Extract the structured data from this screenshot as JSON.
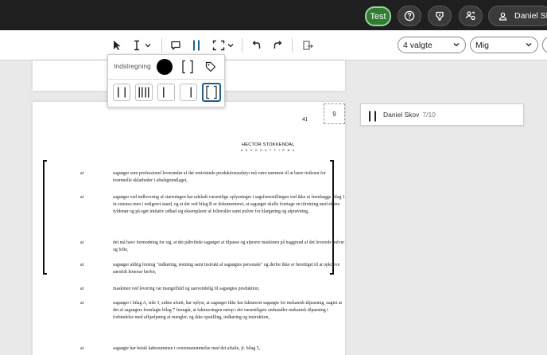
{
  "topbar": {
    "test_label": "Test",
    "help_icon": "help-circle-icon",
    "download_icon": "download-icon",
    "people_icon": "people-icon",
    "user_name": "Daniel Sk"
  },
  "toolbar": {
    "tools": [
      "pointer",
      "text-cursor",
      "comment",
      "redaction-bars",
      "selection-frame",
      "undo",
      "redo",
      "export"
    ],
    "filter_value": "4 valgte",
    "user_filter_value": "Mig"
  },
  "popup": {
    "label": "Indstregning",
    "color": "#000000",
    "styles": [
      "two-bars",
      "triple-bars",
      "left-bar",
      "right-bar",
      "brackets"
    ],
    "selected_style": "brackets"
  },
  "document": {
    "page_number_text": "41",
    "page_box": "9",
    "letterhead": "HECTOR STOKKENDAL",
    "letterhead_sub": "A D V O K A T F I R M A",
    "paragraphs": [
      {
        "label": "at",
        "text": "sagsøger som professionel leverandør af det omtvistede produktionsudstyr må være nærmest til at bære risikoen for eventuelle uklarheder i aftalegrundlaget,"
      },
      {
        "label": "at",
        "text": "sagsøger ved indlevering af stævningen har udeladt væsentlige oplysninger i sagsfremstillingen ved ikke at fremlægge bilag 1 in extenso men i redigeret stand, og at det ved bilag B er dokumenteret, at sagsøger skulle foretage en tilretning med ekstra fyldenør og på eget initiativ udbad sig eksemplarer af folieruller samt pulver for klargøring og afprøvning,"
      },
      {
        "label": "at",
        "text": "det må have formodning for sig, at det påhvilede sagsøger at tilpasse og afprøve maskinen på baggrund af det leverede pulver og folie,"
      },
      {
        "label": "at",
        "text": "sagsøger aldrig foretog \"indkøring, testning samt instrukt af sagsøgtes personale\" og derfor ikke er berettiget til at opkræve særskilt honorar herfor,"
      },
      {
        "label": "at",
        "text": "maskinen ved levering var mangelfuld og uanvendelig til sagsøgtes produktion,"
      },
      {
        "label": "at",
        "text": "sagsøger i bilag A, side 3, sidste afsnit, har oplyst, at sagsøger ikke har faktureret sagsøgte for mekanisk tilpasning, uagtet at det af sagsøgers fremlagte bilag 7 fremgår, at faktureringen netop i det væsentligste omhandler mekanisk tilpasning i forbindelse med afhjælpning af mangler, og ikke opstilling, indkøring og instruktion,"
      },
      {
        "label": "at",
        "text": "sagsøgte har betalt købesummen i overensstemmelse med det aftalte, jf. bilag 5,"
      }
    ]
  },
  "annotation": {
    "author": "Daniel Skov",
    "count": "7/10"
  },
  "colors": {
    "topbar": "#1f1f1f",
    "test_button": "#2e7d32",
    "accent_selected": "#1e5f8c"
  }
}
